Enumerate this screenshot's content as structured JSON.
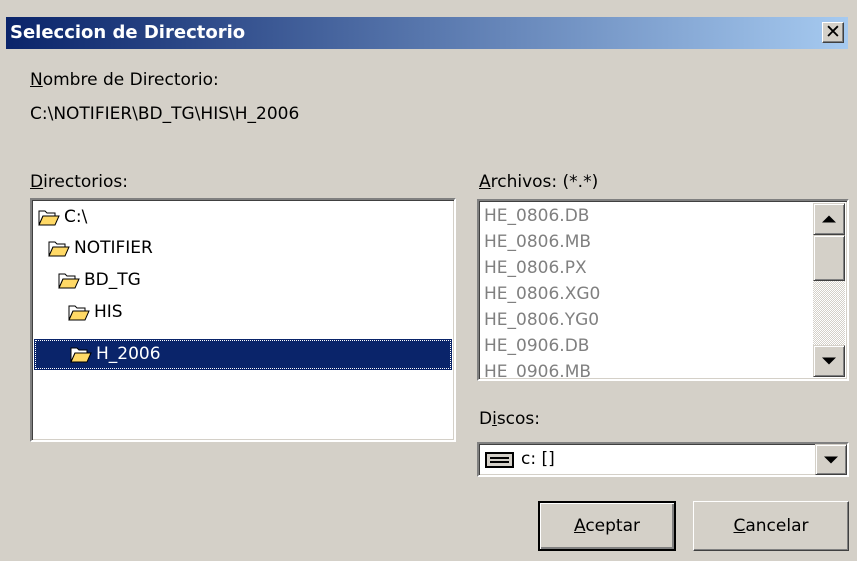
{
  "window": {
    "title": "Seleccion de Directorio",
    "close_glyph": "✕"
  },
  "directory_name": {
    "label_mnemonic": "N",
    "label_rest": "ombre de Directorio:",
    "value": "C:\\NOTIFIER\\BD_TG\\HIS\\H_2006"
  },
  "directories": {
    "label_mnemonic": "D",
    "label_rest": "irectorios:",
    "items": [
      {
        "name": "C:\\",
        "icon": "open-folder-icon"
      },
      {
        "name": "NOTIFIER",
        "icon": "open-folder-icon"
      },
      {
        "name": "BD_TG",
        "icon": "open-folder-icon"
      },
      {
        "name": "HIS",
        "icon": "open-folder-icon"
      },
      {
        "name": "H_2006",
        "icon": "open-folder-icon",
        "selected": true
      }
    ]
  },
  "files": {
    "label_mnemonic": "A",
    "label_rest": "rchivos: (*.*)",
    "items": [
      "HE_0806.DB",
      "HE_0806.MB",
      "HE_0806.PX",
      "HE_0806.XG0",
      "HE_0806.YG0",
      "HE_0906.DB",
      "HE_0906.MB"
    ]
  },
  "drives": {
    "label_pre": "D",
    "label_mnemonic": "i",
    "label_rest": "scos:",
    "selected": "c: []",
    "icon": "drive-icon"
  },
  "buttons": {
    "ok": {
      "mnemonic": "A",
      "rest": "ceptar"
    },
    "cancel": {
      "mnemonic": "C",
      "rest": "ancelar"
    }
  },
  "colors": {
    "face": "#d4d0c8",
    "title_start": "#0a246a",
    "title_end": "#a6caf0",
    "selection": "#0a246a"
  }
}
